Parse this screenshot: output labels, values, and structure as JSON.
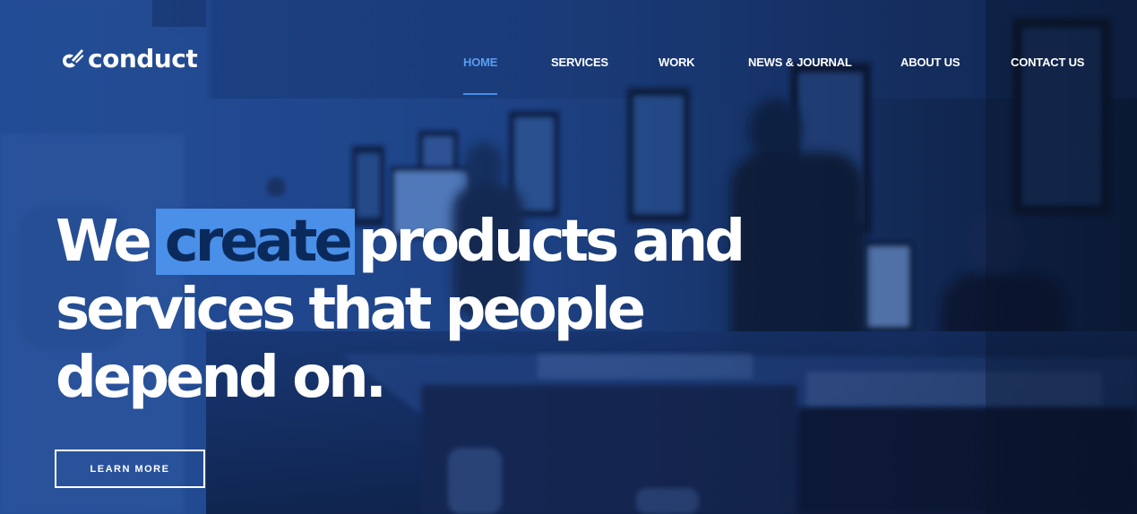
{
  "brand": {
    "name": "conduct",
    "logo_icon": "conduct-mark-icon"
  },
  "nav": {
    "items": [
      {
        "label": "HOME",
        "active": true
      },
      {
        "label": "SERVICES",
        "active": false
      },
      {
        "label": "WORK",
        "active": false
      },
      {
        "label": "NEWS & JOURNAL",
        "active": false
      },
      {
        "label": "ABOUT US",
        "active": false
      },
      {
        "label": "CONTACT US",
        "active": false
      }
    ]
  },
  "hero": {
    "headline_before": "We",
    "headline_highlight": "create",
    "headline_after": "products and services that people depend on.",
    "cta_label": "LEARN MORE"
  },
  "colors": {
    "accent": "#4a8fe8",
    "highlight_text": "#0b2a5c",
    "overlay": "#14326e",
    "text": "#ffffff"
  }
}
